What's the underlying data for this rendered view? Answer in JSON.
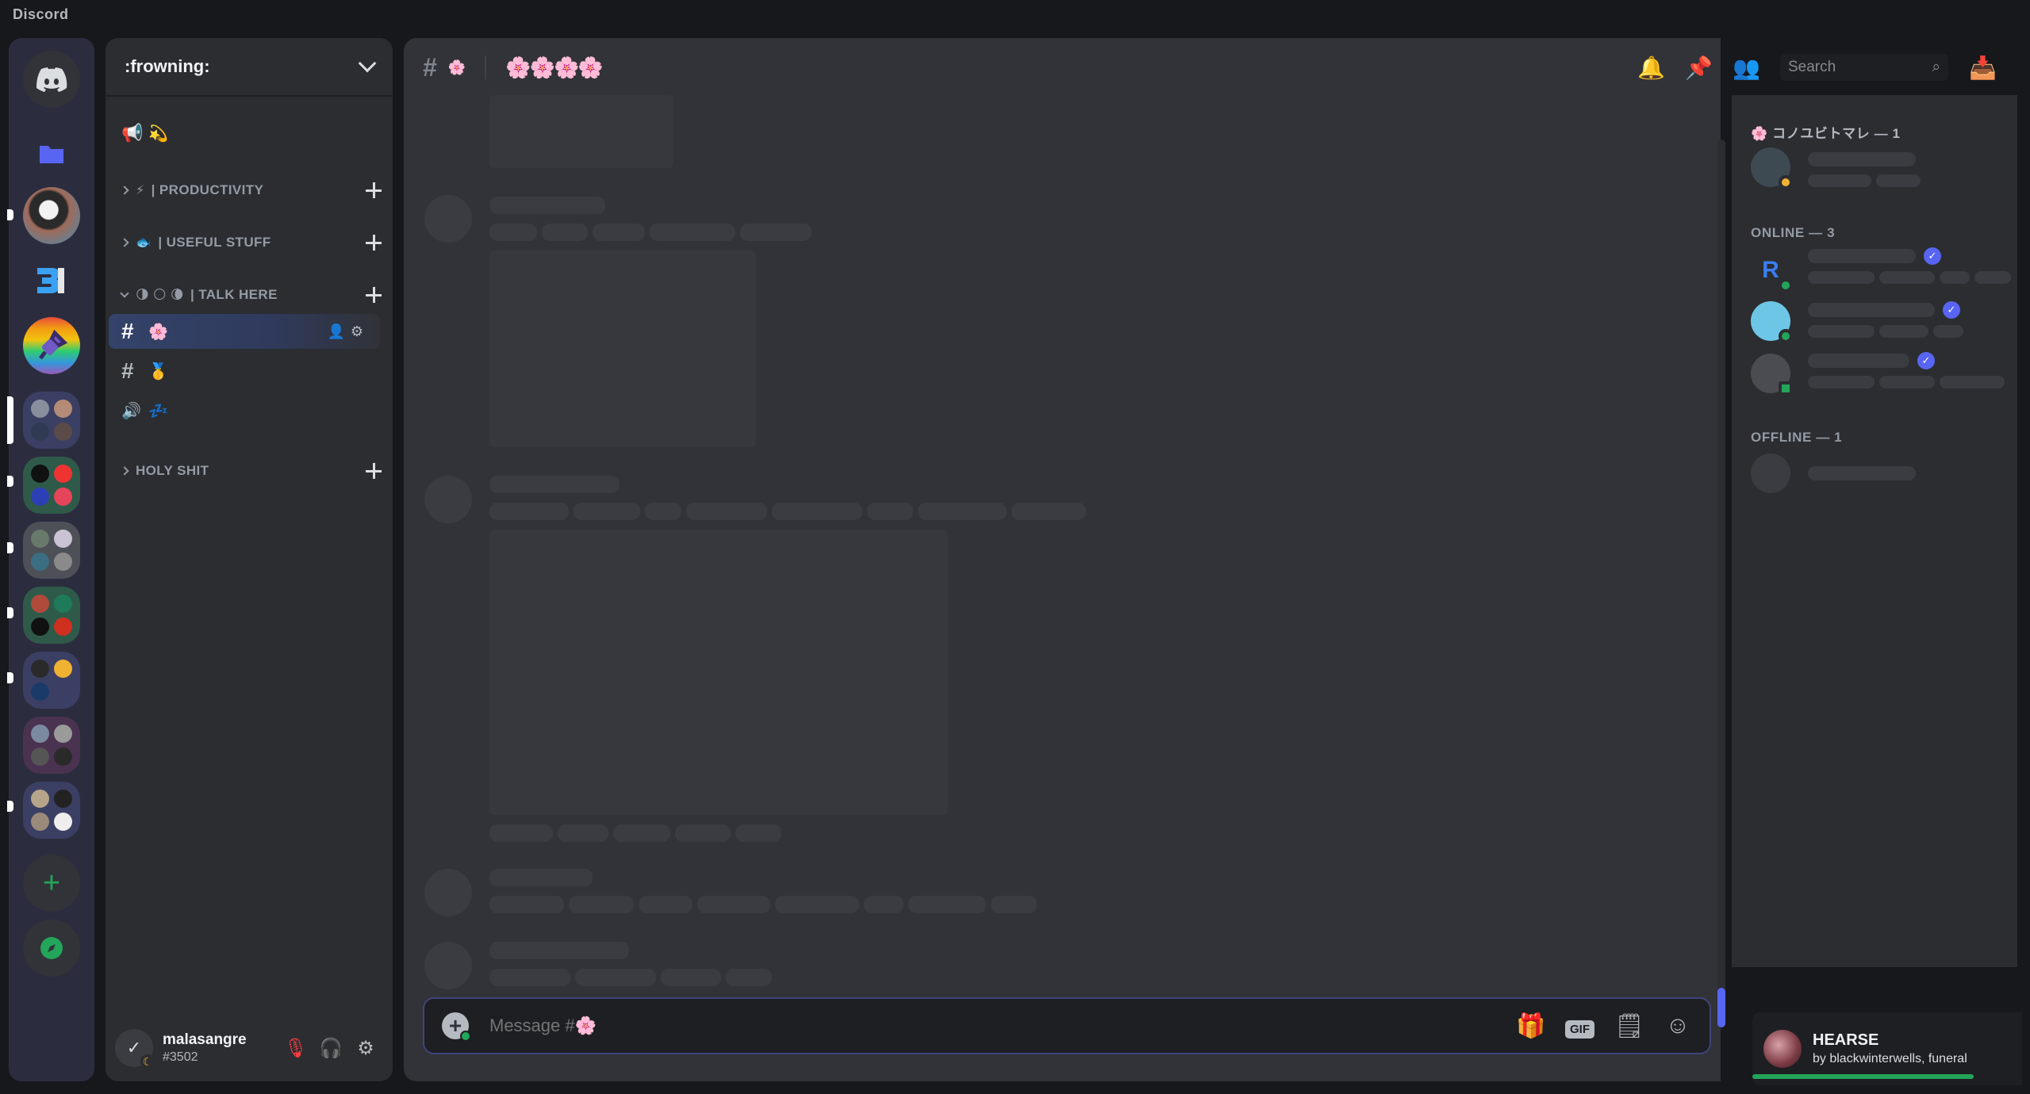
{
  "window": {
    "title": "Discord"
  },
  "servers": {
    "home_icon": "discord-logo-icon",
    "folder_icon": "folder-icon",
    "add_label": "+",
    "explore_icon": "compass-icon"
  },
  "guild": {
    "name": ":frowning:"
  },
  "channels": {
    "top_emoji": "💫",
    "categories": [
      {
        "emoji": "⚡",
        "label": "| PRODUCTIVITY"
      },
      {
        "emoji": "🐟",
        "label": "| USEFUL STUFF"
      },
      {
        "emoji": "🌗 🌕 🌘",
        "label": "| TALK HERE"
      },
      {
        "emoji": "",
        "label": "HOLY SHIT"
      }
    ],
    "items": [
      {
        "hash": "#",
        "name": "🌸"
      },
      {
        "hash": "#",
        "name": "🥇"
      },
      {
        "hash": "🔊",
        "name": "💤"
      }
    ]
  },
  "user": {
    "name": "malasangre",
    "tag": "#3502"
  },
  "chat": {
    "header_hash": "#",
    "header_name": "🌸",
    "topic": "🌸🌸🌸🌸",
    "search_placeholder": "Search",
    "message_placeholder": "Message #🌸",
    "gif_label": "GIF"
  },
  "members": {
    "role_group": "🌸 コノユビトマレ — 1",
    "online_group": "ONLINE — 3",
    "offline_group": "OFFLINE — 1"
  },
  "now_playing": {
    "title": "HEARSE",
    "artist": "by blackwinterwells, funeral",
    "progress": 0.82
  },
  "colors": {
    "accent": "#5865f2",
    "online": "#23a55a",
    "idle": "#f0b232",
    "background": "#313338"
  }
}
